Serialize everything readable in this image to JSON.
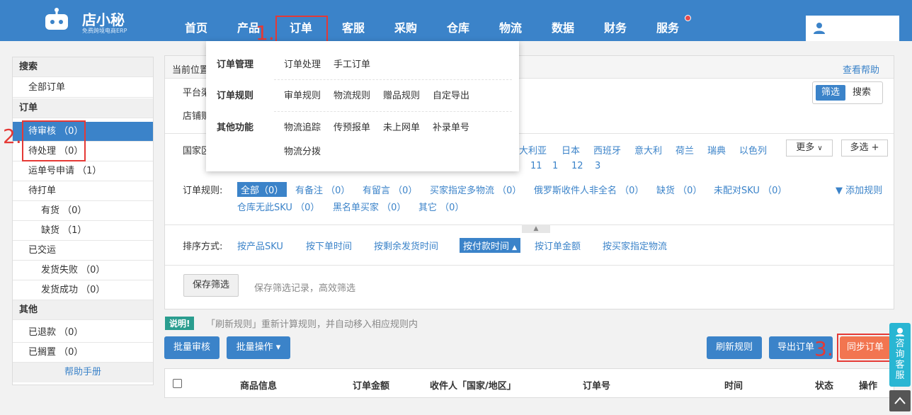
{
  "header": {
    "logo_text": "店小秘",
    "logo_sub": "免费跨境电商ERP",
    "nav": [
      "首页",
      "产品",
      "订单",
      "客服",
      "采购",
      "仓库",
      "物流",
      "数据",
      "财务",
      "服务"
    ]
  },
  "annotations": [
    "1.",
    "2.",
    "3."
  ],
  "sidebar": {
    "search_head": "搜索",
    "all_orders": "全部订单",
    "order_head": "订单",
    "pending_review": "待审核 （0）",
    "pending_process": "待处理 （0）",
    "tracking_apply": "运单号申请 （1）",
    "to_print": "待打单",
    "in_stock": "有货 （0）",
    "out_stock": "缺货 （1）",
    "shipped": "已交运",
    "ship_failed": "发货失败 （0）",
    "ship_success": "发货成功 （0）",
    "other_head": "其他",
    "refunded": "已退款 （0）",
    "on_hold": "已搁置 （0）",
    "help": "帮助手册"
  },
  "panel": {
    "crumb": "当前位置",
    "help_link": "查看帮助",
    "platform_label": "平台渠",
    "shop_label": "店铺贩",
    "tab_filter": "筛选",
    "tab_search": "搜索",
    "country_label": "国家区",
    "countries": [
      "大利亚",
      "日本",
      "西班牙",
      "意大利",
      "荷兰",
      "瑞典",
      "以色列"
    ],
    "more": "更多",
    "multi": "多选 +",
    "country_counts": [
      "11",
      "1",
      "12",
      "3"
    ],
    "rule_label": "订单规则:",
    "rules_row1": [
      "全部（0）",
      "有备注 （0）",
      "有留言 （0）",
      "买家指定多物流 （0）",
      "俄罗斯收件人非全名 （0）",
      "缺货 （0）",
      "未配对SKU （0）"
    ],
    "add_rule": "添加规则",
    "rules_row2": [
      "仓库无此SKU （0）",
      "黑名单买家 （0）",
      "其它 （0）"
    ],
    "sort_label": "排序方式:",
    "sorts": [
      "按产品SKU",
      "按下单时间",
      "按剩余发货时间",
      "按付款时间",
      "按订单金额",
      "按买家指定物流"
    ],
    "save_filter": "保存筛选",
    "save_hint": "保存筛选记录，高效筛选"
  },
  "notice": {
    "badge": "说明!",
    "text": "「刷新规则」重新计算规则，并自动移入相应规则内"
  },
  "actions": {
    "batch_review": "批量审核",
    "batch_ops": "批量操作 ▾",
    "refresh_rules": "刷新规则",
    "export_orders": "导出订单",
    "sync_orders": "同步订单"
  },
  "table": {
    "headers": [
      "商品信息",
      "订单金额",
      "收件人「国家/地区」",
      "订单号",
      "时间",
      "状态",
      "操作"
    ]
  },
  "dropdown": {
    "groups": [
      {
        "title": "订单管理",
        "items": [
          "订单处理",
          "手工订单"
        ]
      },
      {
        "title": "订单规则",
        "items": [
          "审单规则",
          "物流规则",
          "赠品规则",
          "自定导出"
        ]
      },
      {
        "title": "其他功能",
        "items": [
          "物流追踪",
          "传预报单",
          "未上网单",
          "补录单号",
          "物流分拨"
        ]
      }
    ]
  },
  "side_help": "咨询客服",
  "colors": {
    "brand": "#3b83c9",
    "annotation": "#e53935",
    "sync_button": "#f27550",
    "help_side": "#29b6d3"
  }
}
